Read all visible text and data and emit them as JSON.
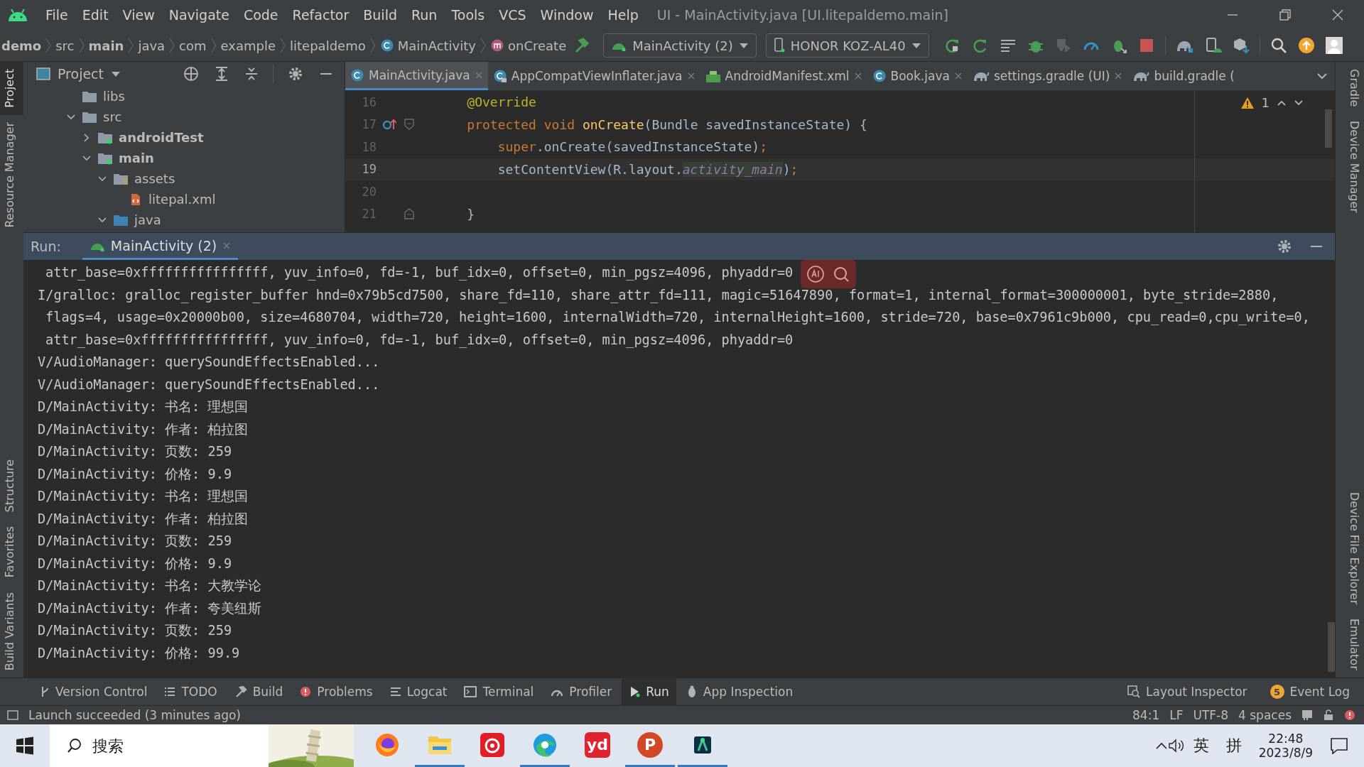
{
  "window": {
    "title": "UI - MainActivity.java [UI.litepaldemo.main]"
  },
  "menu": [
    "File",
    "Edit",
    "View",
    "Navigate",
    "Code",
    "Refactor",
    "Build",
    "Run",
    "Tools",
    "VCS",
    "Window",
    "Help"
  ],
  "breadcrumbs": [
    {
      "label": "demo",
      "kind": "module"
    },
    {
      "label": "src",
      "kind": "folder"
    },
    {
      "label": "main",
      "kind": "module"
    },
    {
      "label": "java",
      "kind": "folder"
    },
    {
      "label": "com",
      "kind": "folder"
    },
    {
      "label": "example",
      "kind": "folder"
    },
    {
      "label": "litepaldemo",
      "kind": "folder"
    },
    {
      "label": "MainActivity",
      "kind": "class"
    },
    {
      "label": "onCreate",
      "kind": "method"
    }
  ],
  "toolbar": {
    "run_config": "MainActivity (2)",
    "device": "HONOR KOZ-AL40"
  },
  "left_stripe": [
    {
      "label": "Project",
      "selected": true
    },
    {
      "label": "Resource Manager",
      "selected": false
    },
    {
      "label": "Structure",
      "selected": false
    },
    {
      "label": "Favorites",
      "selected": false
    },
    {
      "label": "Build Variants",
      "selected": false
    }
  ],
  "right_stripe": [
    {
      "label": "Gradle"
    },
    {
      "label": "Device Manager"
    },
    {
      "label": "Device File Explorer"
    },
    {
      "label": "Emulator"
    }
  ],
  "project": {
    "title": "Project",
    "tree": [
      {
        "label": "libs",
        "kind": "folder"
      },
      {
        "label": "src",
        "kind": "folder",
        "expanded": true,
        "children": [
          {
            "label": "androidTest",
            "kind": "source-root",
            "expanded": false
          },
          {
            "label": "main",
            "kind": "source-root",
            "expanded": true,
            "children": [
              {
                "label": "assets",
                "kind": "resource-folder",
                "expanded": true,
                "children": [
                  {
                    "label": "litepal.xml",
                    "kind": "xml-file"
                  }
                ]
              },
              {
                "label": "java",
                "kind": "java-folder",
                "expanded": true
              }
            ]
          }
        ]
      }
    ]
  },
  "editor": {
    "tabs": [
      {
        "label": "MainActivity.java",
        "kind": "class",
        "selected": true
      },
      {
        "label": "AppCompatViewInflater.java",
        "kind": "locked-class",
        "selected": false
      },
      {
        "label": "AndroidManifest.xml",
        "kind": "manifest",
        "selected": false
      },
      {
        "label": "Book.java",
        "kind": "class",
        "selected": false
      },
      {
        "label": "settings.gradle (UI)",
        "kind": "gradle",
        "selected": false
      },
      {
        "label": "build.gradle (",
        "kind": "gradle",
        "selected": false
      }
    ],
    "warnings": "1",
    "lines": [
      {
        "number": "16",
        "current": false,
        "kind": "plain",
        "tokens": [
          {
            "text": "    @Override",
            "kind": "annotation"
          }
        ]
      },
      {
        "number": "17",
        "current": false,
        "kind": "override-start",
        "tokens": [
          {
            "text": "    protected void ",
            "kind": "keyword"
          },
          {
            "text": "onCreate",
            "kind": "method"
          },
          {
            "text": "(Bundle savedInstanceState) {",
            "kind": "plain"
          }
        ]
      },
      {
        "number": "18",
        "current": false,
        "kind": "plain",
        "tokens": [
          {
            "text": "        super",
            "kind": "keyword"
          },
          {
            "text": ".onCreate(savedInstanceState)",
            "kind": "plain"
          },
          {
            "text": ";",
            "kind": "keyword"
          }
        ]
      },
      {
        "number": "19",
        "current": true,
        "kind": "plain",
        "tokens": [
          {
            "text": "        setContentView(R.layout.",
            "kind": "plain"
          },
          {
            "text": "activity_main",
            "kind": "field"
          },
          {
            "text": ")",
            "kind": "plain"
          },
          {
            "text": ";",
            "kind": "keyword"
          }
        ]
      },
      {
        "number": "20",
        "current": false,
        "kind": "plain"
      },
      {
        "number": "21",
        "current": false,
        "kind": "block-end",
        "tokens": [
          {
            "text": "    }",
            "kind": "plain"
          }
        ]
      }
    ]
  },
  "run": {
    "label": "Run:",
    "tab": "MainActivity (2)",
    "log": [
      {
        "text": "attr_base=0xffffffffffffffff, yuv_info=0, fd=-1, buf_idx=0, offset=0, min_pgsz=4096, phyaddr=0",
        "kind": "continuation"
      },
      {
        "text": "I/gralloc: gralloc_register_buffer hnd=0x79b5cd7500, share_fd=110, share_attr_fd=111, magic=51647890, format=1, internal_format=300000001, byte_stride=2880,",
        "kind": "entry"
      },
      {
        "text": "flags=4, usage=0x20000b00, size=4680704, width=720, height=1600, internalWidth=720, internalHeight=1600, stride=720, base=0x7961c9b000, cpu_read=0,cpu_write=0,",
        "kind": "continuation"
      },
      {
        "text": "attr_base=0xffffffffffffffff, yuv_info=0, fd=-1, buf_idx=0, offset=0, min_pgsz=4096, phyaddr=0",
        "kind": "continuation"
      },
      {
        "text": "V/AudioManager: querySoundEffectsEnabled...",
        "kind": "entry"
      },
      {
        "text": "V/AudioManager: querySoundEffectsEnabled...",
        "kind": "entry"
      },
      {
        "text": "D/MainActivity: 书名: 理想国",
        "kind": "entry"
      },
      {
        "text": "D/MainActivity: 作者: 柏拉图",
        "kind": "entry"
      },
      {
        "text": "D/MainActivity: 页数: 259",
        "kind": "entry"
      },
      {
        "text": "D/MainActivity: 价格: 9.9",
        "kind": "entry"
      },
      {
        "text": "D/MainActivity: 书名: 理想国",
        "kind": "entry"
      },
      {
        "text": "D/MainActivity: 作者: 柏拉图",
        "kind": "entry"
      },
      {
        "text": "D/MainActivity: 页数: 259",
        "kind": "entry"
      },
      {
        "text": "D/MainActivity: 价格: 9.9",
        "kind": "entry"
      },
      {
        "text": "D/MainActivity: 书名: 大教学论",
        "kind": "entry"
      },
      {
        "text": "D/MainActivity: 作者: 夸美纽斯",
        "kind": "entry"
      },
      {
        "text": "D/MainActivity: 页数: 259",
        "kind": "entry"
      },
      {
        "text": "D/MainActivity: 价格: 99.9",
        "kind": "entry"
      }
    ]
  },
  "tool_windows": [
    {
      "label": "Version Control",
      "kind": "vcs",
      "selected": false
    },
    {
      "label": "TODO",
      "kind": "todo",
      "selected": false
    },
    {
      "label": "Build",
      "kind": "build",
      "selected": false
    },
    {
      "label": "Problems",
      "kind": "problems",
      "selected": false
    },
    {
      "label": "Logcat",
      "kind": "logcat",
      "selected": false
    },
    {
      "label": "Terminal",
      "kind": "terminal",
      "selected": false
    },
    {
      "label": "Profiler",
      "kind": "profiler",
      "selected": false
    },
    {
      "label": "Run",
      "kind": "run",
      "selected": true
    },
    {
      "label": "App Inspection",
      "kind": "inspection",
      "selected": false
    }
  ],
  "tool_windows_right": [
    {
      "label": "Layout Inspector",
      "kind": "layout"
    },
    {
      "label": "Event Log",
      "kind": "event",
      "badge": "5"
    }
  ],
  "status_bar": {
    "message": "Launch succeeded (3 minutes ago)",
    "position": "84:1",
    "line_separator": "LF",
    "encoding": "UTF-8",
    "indent": "4 spaces"
  },
  "taskbar": {
    "search_placeholder": "搜索",
    "apps": [
      {
        "kind": "firefox",
        "active": false
      },
      {
        "kind": "files",
        "active": true
      },
      {
        "kind": "music",
        "active": false
      },
      {
        "kind": "edge",
        "active": true
      },
      {
        "kind": "dict",
        "active": false,
        "label": "yd"
      },
      {
        "kind": "slides",
        "active": true,
        "label": "P"
      },
      {
        "kind": "studio",
        "active": true
      }
    ],
    "input_lang": "英",
    "ime": "拼",
    "time": "22:48",
    "date": "2023/8/9"
  }
}
